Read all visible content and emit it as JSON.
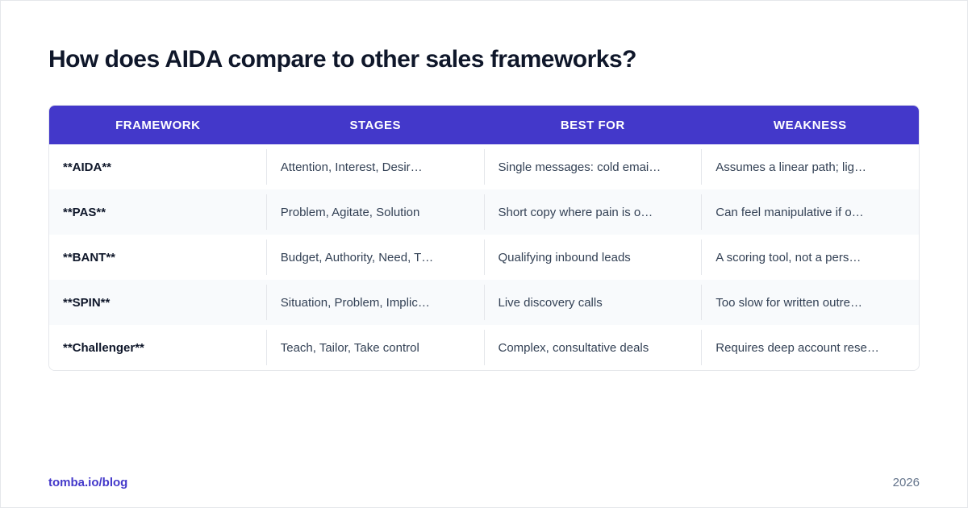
{
  "title": "How does AIDA compare to other sales frameworks?",
  "table": {
    "headers": [
      "FRAMEWORK",
      "STAGES",
      "BEST FOR",
      "WEAKNESS"
    ],
    "rows": [
      [
        "**AIDA**",
        "Attention, Interest, Desir…",
        "Single messages: cold emai…",
        "Assumes a linear path; lig…"
      ],
      [
        "**PAS**",
        "Problem, Agitate, Solution",
        "Short copy where pain is o…",
        "Can feel manipulative if o…"
      ],
      [
        "**BANT**",
        "Budget, Authority, Need, T…",
        "Qualifying inbound leads",
        "A scoring tool, not a pers…"
      ],
      [
        "**SPIN**",
        "Situation, Problem, Implic…",
        "Live discovery calls",
        "Too slow for written outre…"
      ],
      [
        "**Challenger**",
        "Teach, Tailor, Take control",
        "Complex, consultative deals",
        "Requires deep account rese…"
      ]
    ]
  },
  "footer": {
    "source": "tomba.io/blog",
    "year": "2026"
  },
  "colors": {
    "header_bg": "#4338ca",
    "title": "#0f172a",
    "accent": "#4338ca",
    "row_alt_bg": "#f8fafc"
  }
}
